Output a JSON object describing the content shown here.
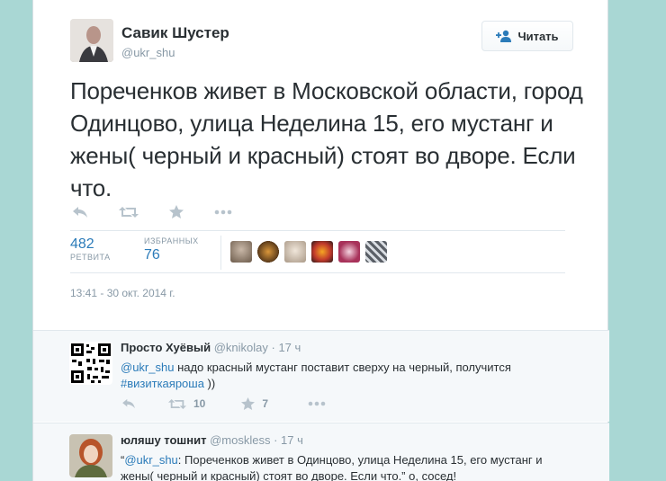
{
  "tweet": {
    "author_name": "Савик Шустер",
    "author_handle": "@ukr_shu",
    "follow_label": "Читать",
    "text": "Пореченков живет в Московской области, город Одинцово, улица Неделина 15, его мустанг и жены( черный и красный) стоят во дворе. Если что.",
    "retweets_count": "482",
    "retweets_label": "РЕТВИТА",
    "favorites_label": "ИЗБРАННЫХ",
    "favorites_count": "76",
    "timestamp": "13:41 - 30 окт. 2014 г."
  },
  "replies": [
    {
      "name": "Просто Хуёвый",
      "handle": "@knikolay",
      "time": "· 17 ч",
      "mention": "@ukr_shu",
      "text_part1": " надо красный мустанг поставит сверху на черный, получится ",
      "hashtag": "#визиткаяроша",
      "text_part2": " ))",
      "retweet_count": "10",
      "favorite_count": "7"
    },
    {
      "name": "юляшу тошнит",
      "handle": "@moskless",
      "time": "· 17 ч",
      "quote_open": "“",
      "mention": "@ukr_shu",
      "text": ": Пореченков живет в Одинцово, улица Неделина 15, его мустанг и жены( черный и красный) стоят во дворе. Если что.” о, сосед!"
    }
  ],
  "icons": {
    "reply": "reply-icon",
    "retweet": "retweet-icon",
    "favorite": "star-icon",
    "more": "more-icon",
    "follow": "add-user-icon"
  },
  "colors": {
    "link": "#2b7bb9",
    "muted": "#8899a6",
    "background": "#a8d8d5"
  }
}
